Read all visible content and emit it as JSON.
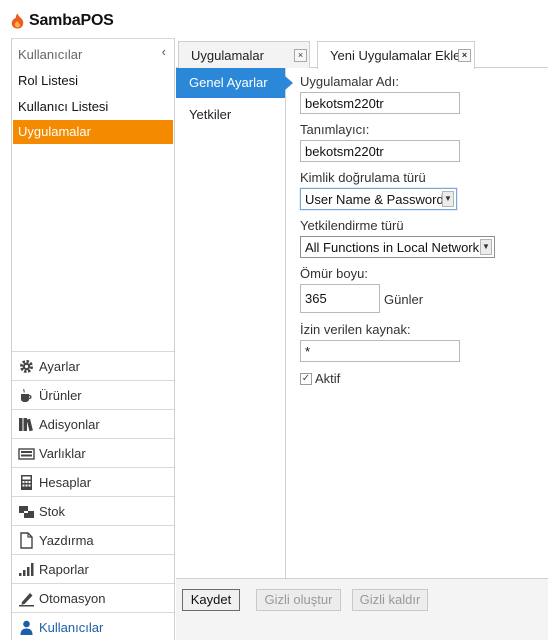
{
  "app": {
    "title": "SambaPOS",
    "logo_icon": "orange-flame-icon",
    "accent": "#f38a00"
  },
  "sidebar": {
    "header": "Kullanıcılar",
    "collapse_glyph": "‹",
    "sub_items": [
      {
        "label": "Rol Listesi",
        "active": false
      },
      {
        "label": "Kullanıcı Listesi",
        "active": false
      },
      {
        "label": "Uygulamalar",
        "active": true
      }
    ],
    "categories": [
      {
        "label": "Ayarlar",
        "icon": "gear-icon"
      },
      {
        "label": "Ürünler",
        "icon": "coffee-cup-icon"
      },
      {
        "label": "Adisyonlar",
        "icon": "books-icon"
      },
      {
        "label": "Varlıklar",
        "icon": "keyboard-icon"
      },
      {
        "label": "Hesaplar",
        "icon": "calculator-icon"
      },
      {
        "label": "Stok",
        "icon": "boxes-icon"
      },
      {
        "label": "Yazdırma",
        "icon": "document-icon"
      },
      {
        "label": "Raporlar",
        "icon": "bar-chart-icon"
      },
      {
        "label": "Otomasyon",
        "icon": "pencil-icon"
      },
      {
        "label": "Kullanıcılar",
        "icon": "user-icon",
        "active": true
      }
    ]
  },
  "tabs": [
    {
      "label": "Uygulamalar",
      "close": "×",
      "active": false
    },
    {
      "label": "Yeni Uygulamalar Ekle",
      "close": "×",
      "active": true
    }
  ],
  "left_nav": [
    {
      "label": "Genel Ayarlar",
      "active": true
    },
    {
      "label": "Yetkiler",
      "active": false
    }
  ],
  "form": {
    "app_name": {
      "label": "Uygulamalar Adı:",
      "value": "bekotsm220tr"
    },
    "identifier": {
      "label": "Tanımlayıcı:",
      "value": "bekotsm220tr"
    },
    "auth_type": {
      "label": "Kimlik doğrulama türü",
      "value": "User Name & Password"
    },
    "authz_type": {
      "label": "Yetkilendirme türü",
      "value": "All Functions in Local Network"
    },
    "lifetime": {
      "label": "Ömür boyu:",
      "value": "365",
      "unit": "Günler"
    },
    "allowed_source": {
      "label": "İzin verilen kaynak:",
      "value": "*"
    },
    "active": {
      "label": "Aktif",
      "checked": true,
      "check_glyph": "✓"
    }
  },
  "buttons": {
    "save": "Kaydet",
    "generate_secret": "Gizli oluştur",
    "remove_secret": "Gizli kaldır"
  }
}
